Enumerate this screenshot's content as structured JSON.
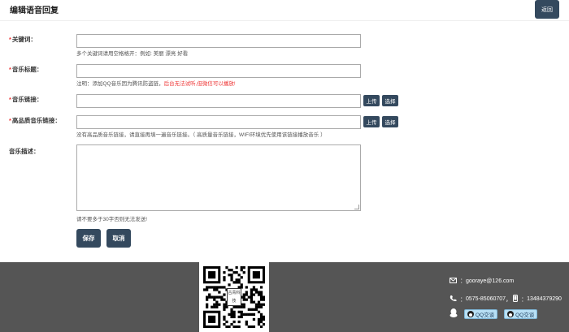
{
  "header": {
    "title": "编辑语音回复",
    "back_label": "返回"
  },
  "form": {
    "keyword": {
      "label": "关键词：",
      "value": "",
      "hint": "多个关键词请用空格格开：例如: 美丽 漂亮 好看"
    },
    "music_title": {
      "label": "音乐标题：",
      "value": "",
      "hint_prefix": "注明：添加QQ音乐因为腾讯防盗链，",
      "hint_red": "后台无法试听,但微信可以播放!"
    },
    "music_link": {
      "label": "音乐链接：",
      "value": "",
      "upload_label": "上传",
      "select_label": "选择"
    },
    "hq_music_link": {
      "label": "高品质音乐链接：",
      "value": "",
      "upload_label": "上传",
      "select_label": "选择",
      "hint": "没有高品质音乐链接，请直接再填一遍音乐链接。（ 高质量音乐链接，WIFI环境优先使用该链接播放音乐 ）"
    },
    "description": {
      "label": "音乐描述：",
      "value": "",
      "hint": "请不要多于30字否则无法发送!"
    },
    "required_mark": "*"
  },
  "actions": {
    "save_label": "保存",
    "cancel_label": "取消"
  },
  "footer": {
    "qr_text": "古青科技",
    "email_icon": "envelope-icon",
    "email": "gooraye@126.com",
    "phone_text": "0575-85060707",
    "mobile_text": "13484379290",
    "qq_label_1": "QQ交谈",
    "qq_label_2": "QQ交谈",
    "sep1": "：",
    "sep2": "：",
    "sep3": "，",
    "sep4": "："
  }
}
